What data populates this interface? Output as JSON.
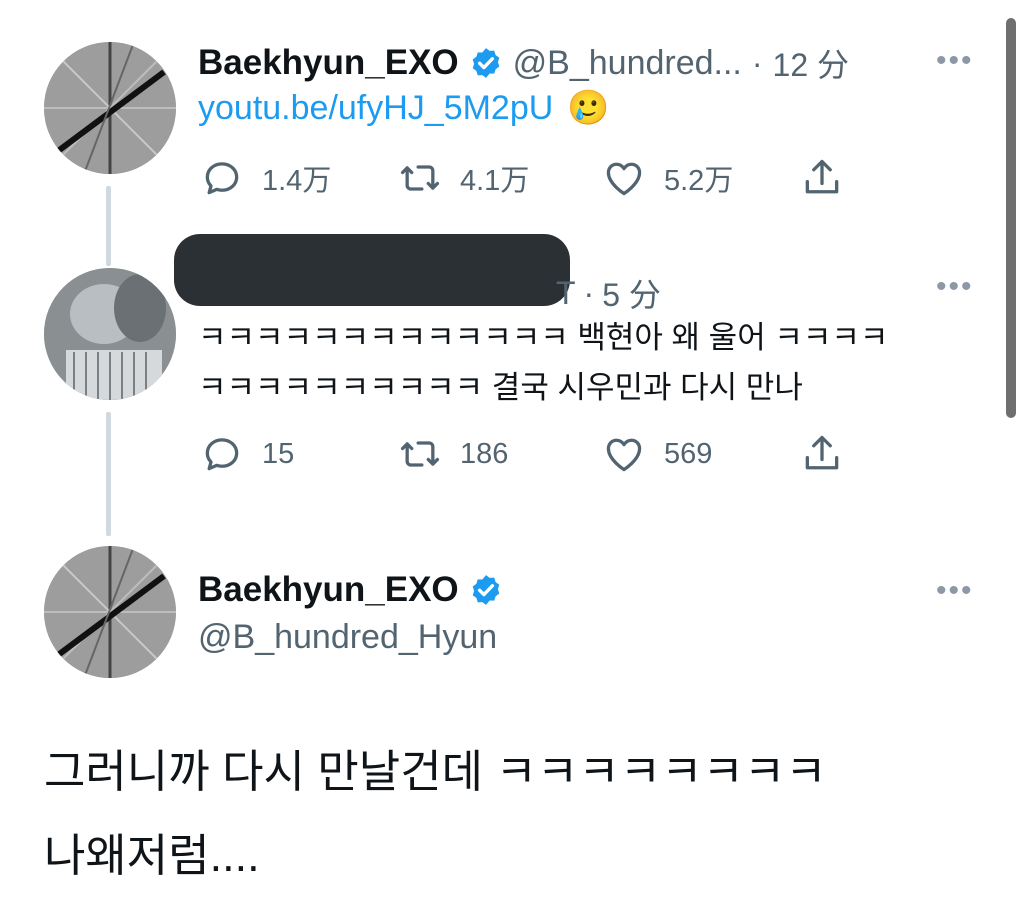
{
  "tweets": [
    {
      "author": "Baekhyun_EXO",
      "handle": "@B_hundred...",
      "separator": "·",
      "time": "12 分",
      "link": "youtu.be/ufyHJ_5M2pU",
      "emoji": "🥲",
      "more": "•••",
      "counts": {
        "replies": "1.4万",
        "retweets": "4.1万",
        "likes": "5.2万"
      }
    },
    {
      "handle_tail": "T",
      "separator": "·",
      "time": "5 分",
      "more": "•••",
      "lines": [
        "ㅋㅋㅋㅋㅋㅋㅋㅋㅋㅋㅋㅋㅋ 백현아 왜 울어 ㅋㅋㅋㅋ",
        "ㅋㅋㅋㅋㅋㅋㅋㅋㅋㅋ 결국 시우민과 다시 만나"
      ],
      "counts": {
        "replies": "15",
        "retweets": "186",
        "likes": "569"
      }
    },
    {
      "author": "Baekhyun_EXO",
      "handle": "@B_hundred_Hyun",
      "more": "•••",
      "lines": [
        "그러니까 다시 만날건데 ㅋㅋㅋㅋㅋㅋㅋㅋ",
        "나왜저럼...."
      ]
    }
  ],
  "icons": [
    "reply-icon",
    "retweet-icon",
    "like-icon",
    "share-icon",
    "verified-badge-icon"
  ],
  "colors": {
    "link": "#1d9bf0",
    "verified": "#1d9bf0",
    "secondary_text": "#536471"
  }
}
